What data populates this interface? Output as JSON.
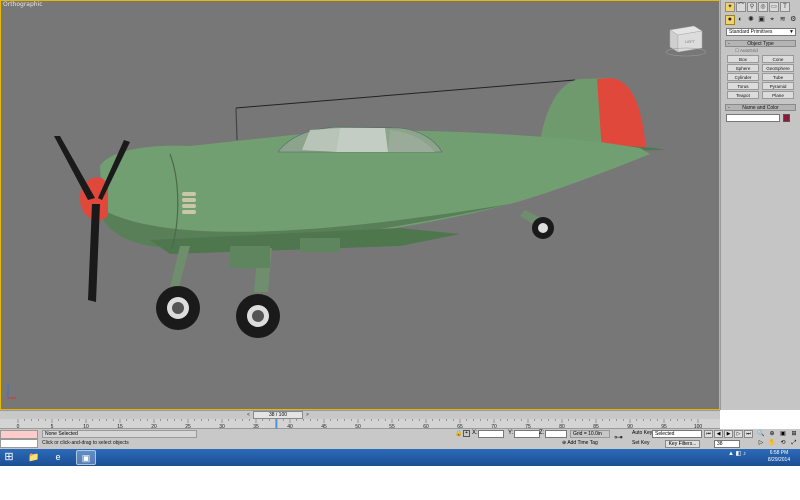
{
  "viewport": {
    "label": "Orthographic",
    "viewcube_label": "LEFT"
  },
  "command_panel": {
    "dropdown": "Standard Primitives",
    "object_type_title": "Object Type",
    "autogrid": "AutoGrid",
    "buttons": [
      "Box",
      "Cone",
      "Sphere",
      "GeoSphere",
      "Cylinder",
      "Tube",
      "Torus",
      "Pyramid",
      "Teapot",
      "Plane"
    ],
    "name_color_title": "Name and Color",
    "color": "#8b1a3a",
    "tab_icons": [
      "create-tab-icon",
      "modify-tab-icon",
      "hierarchy-tab-icon",
      "motion-tab-icon",
      "display-tab-icon",
      "utilities-tab-icon"
    ]
  },
  "timeline": {
    "frame_display": "38 / 100",
    "ticks": [
      0,
      5,
      10,
      15,
      20,
      25,
      30,
      35,
      40,
      45,
      50,
      55,
      60,
      65,
      70,
      75,
      80,
      85,
      90,
      95,
      100
    ]
  },
  "status": {
    "selection": "None Selected",
    "prompt": "Click or click-and-drag to select objects",
    "x_label": "X:",
    "y_label": "Y:",
    "z_label": "Z:",
    "grid": "Grid = 10.0in",
    "add_time_tag": "Add Time Tag",
    "auto_key": "Auto Key",
    "set_key": "Set Key",
    "selected_option": "Selected",
    "key_filters": "Key Filters...",
    "current_frame": "38"
  },
  "taskbar": {
    "time": "6:58 PM",
    "date": "8/29/2014"
  }
}
